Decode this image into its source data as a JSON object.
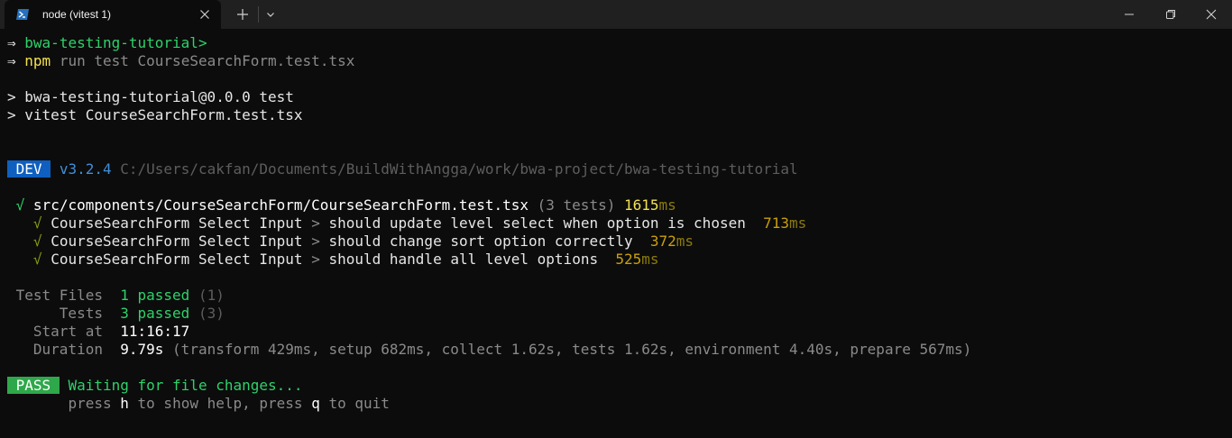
{
  "window": {
    "tab_title": "node (vitest 1)",
    "icon": "powershell-icon"
  },
  "lines": {
    "l1": {
      "prompt": "⇒",
      "text": "bwa-testing-tutorial>"
    },
    "l2": {
      "prompt": "⇒",
      "cmd": "npm",
      "args": "run test CourseSearchForm.test.tsx"
    },
    "l3": "> bwa-testing-tutorial@0.0.0 test",
    "l4": "> vitest CourseSearchForm.test.tsx",
    "dev": {
      "badge": "DEV",
      "version": "v3.2.4",
      "path": "C:/Users/cakfan/Documents/BuildWithAngga/work/bwa-project/bwa-testing-tutorial"
    },
    "file": {
      "check": "√",
      "path": "src/components/CourseSearchForm/CourseSearchForm.test.tsx",
      "count": "(3 tests)",
      "time": "1615",
      "unit": "ms"
    },
    "tests": [
      {
        "check": "√",
        "suite": "CourseSearchForm Select Input",
        "sep": ">",
        "name": "should update level select when option is chosen",
        "time": "713",
        "unit": "ms"
      },
      {
        "check": "√",
        "suite": "CourseSearchForm Select Input",
        "sep": ">",
        "name": "should change sort option correctly",
        "time": "372",
        "unit": "ms"
      },
      {
        "check": "√",
        "suite": "CourseSearchForm Select Input",
        "sep": ">",
        "name": "should handle all level options",
        "time": "525",
        "unit": "ms"
      }
    ],
    "summary": {
      "files_label": "Test Files",
      "files_value": "1 passed",
      "files_total": "(1)",
      "tests_label": "Tests",
      "tests_value": "3 passed",
      "tests_total": "(3)",
      "start_label": "Start at",
      "start_value": "11:16:17",
      "duration_label": "Duration",
      "duration_value": "9.79s",
      "duration_detail": "(transform 429ms, setup 682ms, collect 1.62s, tests 1.62s, environment 4.40s, prepare 567ms)"
    },
    "pass": {
      "badge": "PASS",
      "text": "Waiting for file changes..."
    },
    "help": {
      "t1": "press",
      "k1": "h",
      "t2": "to show help, press",
      "k2": "q",
      "t3": "to quit"
    }
  }
}
